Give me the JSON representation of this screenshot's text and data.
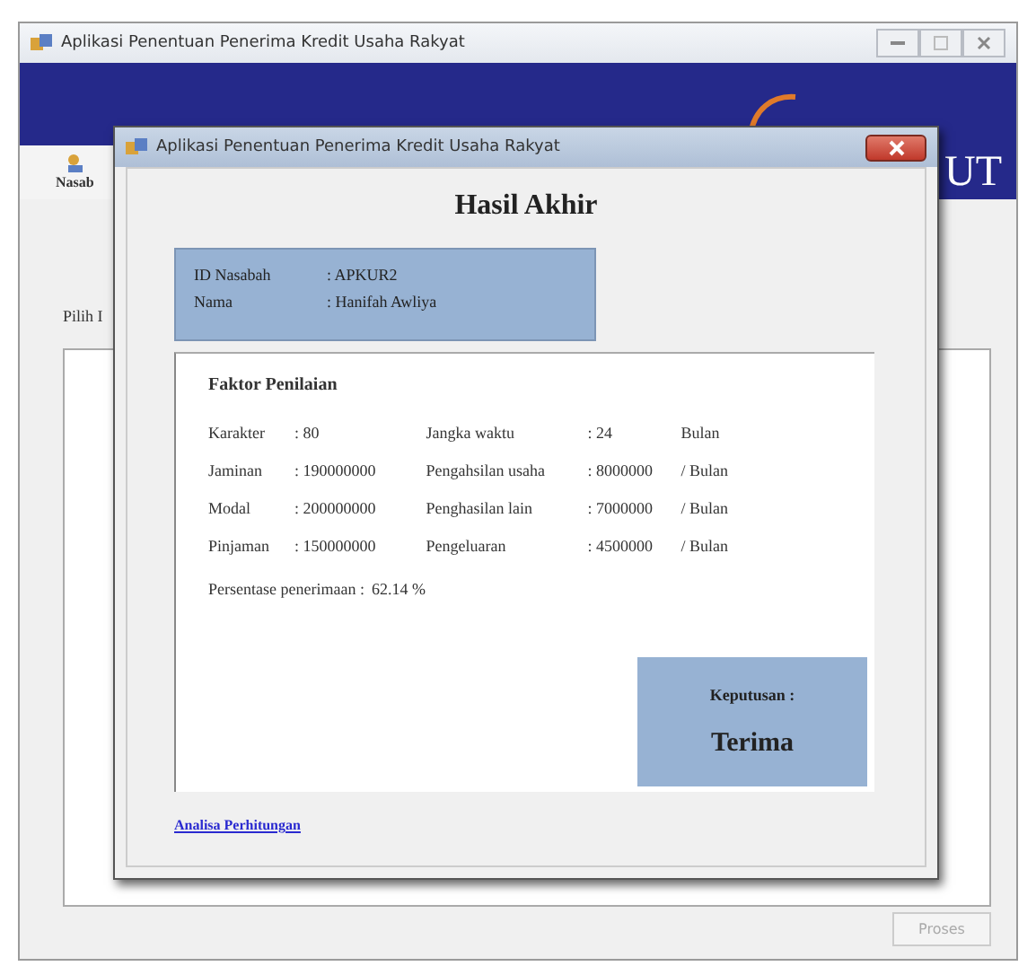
{
  "main_window": {
    "title": "Aplikasi Penentuan Penerima Kredit Usaha Rakyat",
    "logo_text": "UT",
    "tab_label": "Nasab",
    "pilih_label": "Pilih I",
    "process_button": {
      "label": "Proses",
      "disabled": true
    }
  },
  "dialog": {
    "title": "Aplikasi Penentuan Penerima Kredit Usaha Rakyat",
    "heading": "Hasil Akhir",
    "customer": [
      {
        "label": "ID Nasabah",
        "value": ": APKUR2"
      },
      {
        "label": "Nama",
        "value": ": Hanifah Awliya"
      }
    ],
    "factors_title": "Faktor Penilaian",
    "left_factors": [
      {
        "label": "Karakter",
        "value": ": 80"
      },
      {
        "label": "Jaminan",
        "value": ": 190000000"
      },
      {
        "label": "Modal",
        "value": ": 200000000"
      },
      {
        "label": "Pinjaman",
        "value": ": 150000000"
      }
    ],
    "right_factors": [
      {
        "label": "Jangka waktu",
        "value": ": 24",
        "unit": "Bulan"
      },
      {
        "label": "Pengahsilan usaha",
        "value": ": 8000000",
        "unit": "/ Bulan"
      },
      {
        "label": "Penghasilan lain",
        "value": ": 7000000",
        "unit": "/ Bulan"
      },
      {
        "label": "Pengeluaran",
        "value": ": 4500000",
        "unit": "/ Bulan"
      }
    ],
    "percentage": {
      "label": "Persentase penerimaan :",
      "value": "62.14 %"
    },
    "decision": {
      "label": "Keputusan :",
      "value": "Terima"
    },
    "link": "Analisa Perhitungan"
  }
}
